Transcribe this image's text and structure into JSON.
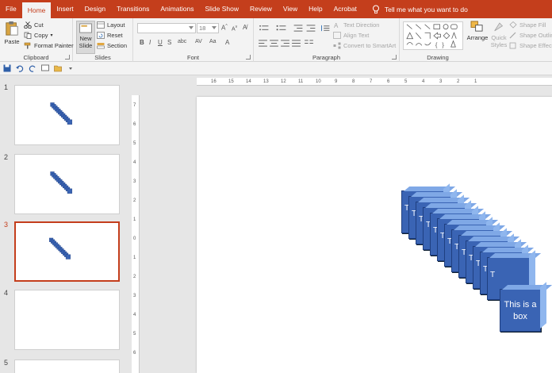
{
  "ribbon_tabs": [
    "File",
    "Home",
    "Insert",
    "Design",
    "Transitions",
    "Animations",
    "Slide Show",
    "Review",
    "View",
    "Help",
    "Acrobat"
  ],
  "active_tab": "Home",
  "tell_me": "Tell me what you want to do",
  "clipboard": {
    "paste": "Paste",
    "cut": "Cut",
    "copy": "Copy",
    "format_painter": "Format Painter",
    "label": "Clipboard"
  },
  "slides_group": {
    "new_slide_1": "New",
    "new_slide_2": "Slide",
    "layout": "Layout",
    "reset": "Reset",
    "section": "Section",
    "label": "Slides"
  },
  "font_group": {
    "font_name": "",
    "font_size": "18",
    "bold": "B",
    "italic": "I",
    "underline": "U",
    "strike": "S",
    "label": "Font"
  },
  "paragraph_group": {
    "text_direction": "Text Direction",
    "align_text": "Align Text",
    "convert_smartart": "Convert to SmartArt",
    "label": "Paragraph"
  },
  "drawing_group": {
    "arrange": "Arrange",
    "quick_styles_1": "Quick",
    "quick_styles_2": "Styles",
    "shape_fill": "Shape Fill",
    "shape_outline": "Shape Outline",
    "shape_effects": "Shape Effects",
    "label": "Drawing"
  },
  "slides": [
    {
      "number": "1",
      "selected": false
    },
    {
      "number": "2",
      "selected": false
    },
    {
      "number": "3",
      "selected": true
    },
    {
      "number": "4",
      "selected": false
    },
    {
      "number": "5",
      "selected": false
    }
  ],
  "ruler_numbers": [
    "16",
    "15",
    "14",
    "13",
    "12",
    "11",
    "10",
    "9",
    "8",
    "7",
    "6",
    "5",
    "4",
    "3",
    "2",
    "1"
  ],
  "vruler_numbers": [
    "7",
    "6",
    "5",
    "4",
    "3",
    "2",
    "1",
    "0",
    "1",
    "2",
    "3",
    "4",
    "5",
    "6"
  ],
  "box_stack_letter": "T",
  "box_text": "This is a box",
  "colors": {
    "accent": "#c43e1c",
    "box": "#3a64b4",
    "box_top": "#7fa8e6"
  }
}
